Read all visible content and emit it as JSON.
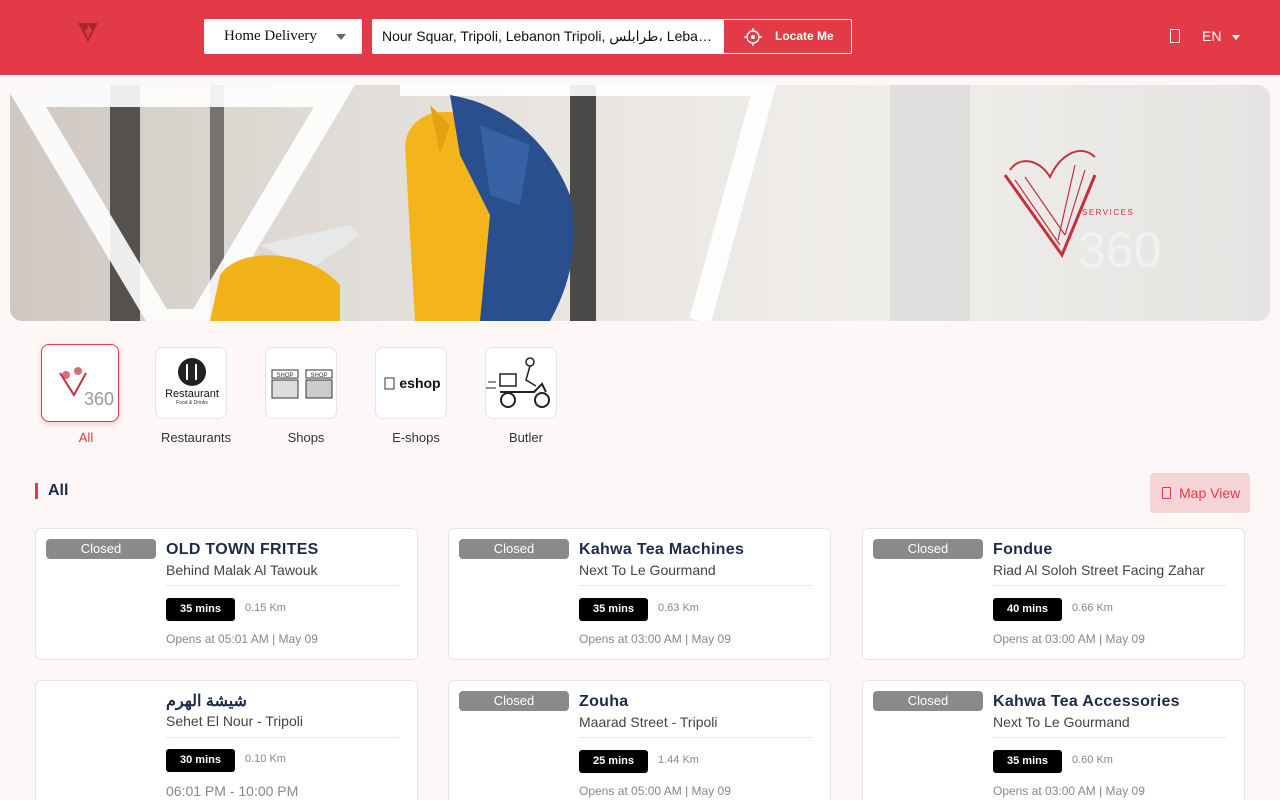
{
  "header": {
    "delivery_mode": "Home Delivery",
    "address": "Nour Squar, Tripoli, Lebanon Tripoli, طرابلس، Lebanon",
    "locate_label": "Locate Me",
    "language": "EN",
    "brand_color": "#e23a47"
  },
  "banner": {
    "brand_small": "SERVICES",
    "brand_number": "360"
  },
  "categories": [
    {
      "label": "All",
      "icon": "services-360-logo-icon"
    },
    {
      "label": "Restaurants",
      "icon": "restaurant-icon",
      "icon_text": "Restaurant",
      "icon_sub": "Food & Drinks"
    },
    {
      "label": "Shops",
      "icon": "shop-icon",
      "icon_text": "SHOP"
    },
    {
      "label": "E-shops",
      "icon": "eshop-icon",
      "icon_text": "eshop"
    },
    {
      "label": "Butler",
      "icon": "delivery-scooter-icon"
    }
  ],
  "section": {
    "title": "All",
    "map_view_label": "Map View"
  },
  "stores": [
    {
      "status": "Closed",
      "name": "OLD TOWN FRITES",
      "address": "Behind Malak Al Tawouk",
      "time": "35 mins",
      "distance": "0.15 Km",
      "opens": "Opens at 05:01 AM | May 09"
    },
    {
      "status": "Closed",
      "name": "Kahwa Tea Machines",
      "address": "Next To Le Gourmand",
      "time": "35 mins",
      "distance": "0.63 Km",
      "opens": "Opens at 03:00 AM | May 09"
    },
    {
      "status": "Closed",
      "name": "Fondue",
      "address": "Riad Al Soloh Street Facing Zahar",
      "time": "40 mins",
      "distance": "0.66 Km",
      "opens": "Opens at 03:00 AM | May 09"
    },
    {
      "status": "",
      "name": "شيشة الهرم",
      "address": "Sehet El Nour - Tripoli",
      "time": "30 mins",
      "distance": "0.10 Km",
      "opens": "06:01 PM - 10:00 PM"
    },
    {
      "status": "Closed",
      "name": "Zouha",
      "address": "Maarad Street - Tripoli",
      "time": "25 mins",
      "distance": "1.44 Km",
      "opens": "Opens at 05:00 AM | May 09"
    },
    {
      "status": "Closed",
      "name": "Kahwa Tea Accessories",
      "address": "Next To Le Gourmand",
      "time": "35 mins",
      "distance": "0.60 Km",
      "opens": "Opens at 03:00 AM | May 09"
    }
  ]
}
